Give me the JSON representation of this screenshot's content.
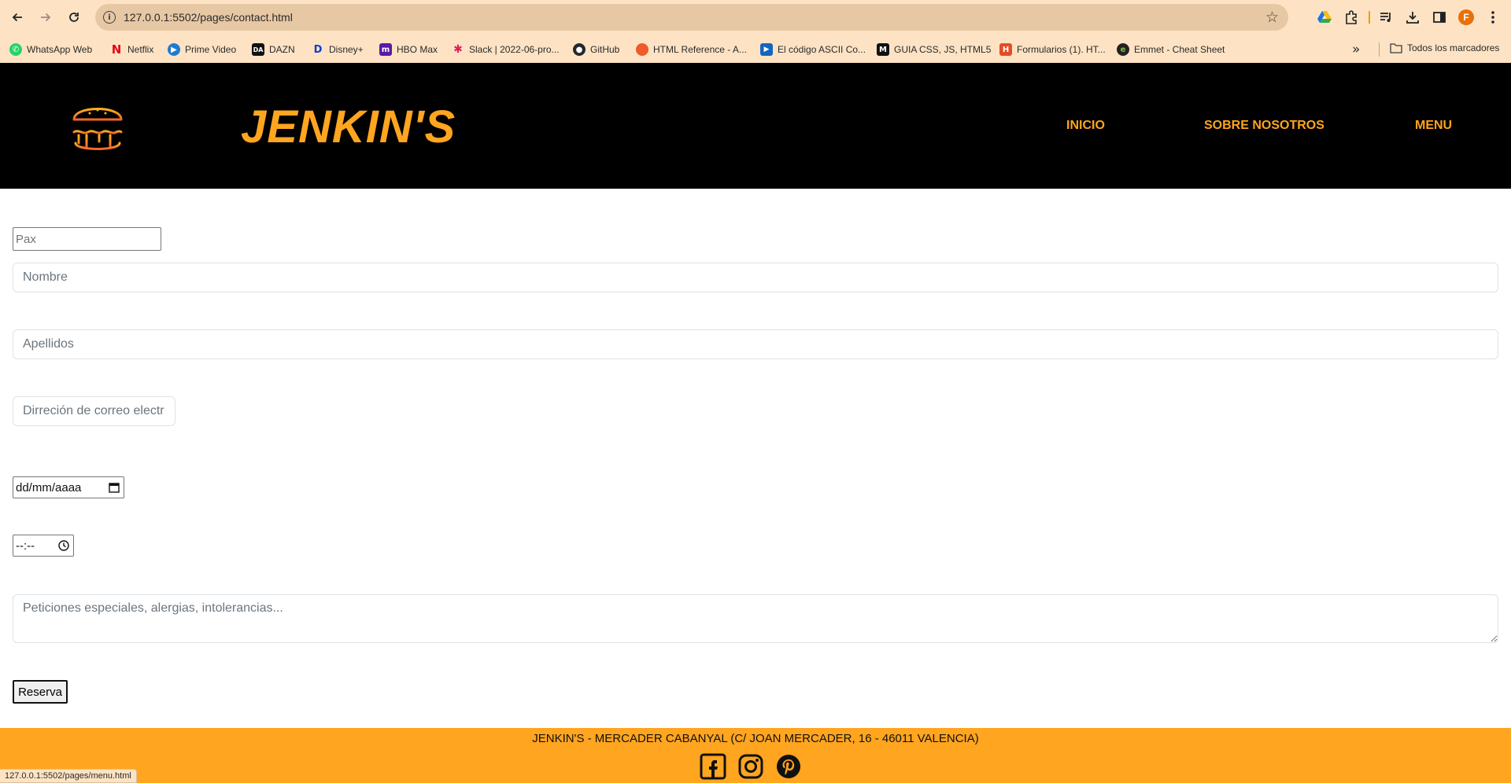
{
  "browser": {
    "url": "127.0.0.1:5502/pages/contact.html",
    "status_link": "127.0.0.1:5502/pages/menu.html",
    "profile_initial": "F",
    "bookmarks": [
      {
        "label": "WhatsApp Web",
        "icon": "whatsapp-icon"
      },
      {
        "label": "Netflix",
        "icon": "netflix-icon"
      },
      {
        "label": "Prime Video",
        "icon": "prime-video-icon"
      },
      {
        "label": "DAZN",
        "icon": "dazn-icon"
      },
      {
        "label": "Disney+",
        "icon": "disney-icon"
      },
      {
        "label": "HBO Max",
        "icon": "hbo-max-icon"
      },
      {
        "label": "Slack | 2022-06-pro...",
        "icon": "slack-icon"
      },
      {
        "label": "GitHub",
        "icon": "github-icon"
      },
      {
        "label": "HTML Reference - A...",
        "icon": "html-reference-icon"
      },
      {
        "label": "El código ASCII Co...",
        "icon": "ascii-icon"
      },
      {
        "label": "GUIA CSS, JS, HTML5",
        "icon": "guia-icon"
      },
      {
        "label": "Formularios (1). HT...",
        "icon": "html5-icon"
      },
      {
        "label": "Emmet - Cheat Sheet",
        "icon": "emmet-icon"
      }
    ],
    "all_bookmarks_label": "Todos los marcadores"
  },
  "header": {
    "brand": "JENKIN'S",
    "nav": [
      "INICIO",
      "SOBRE NOSOTROS",
      "MENU"
    ],
    "accent_color": "#ffa51f"
  },
  "form": {
    "pax_placeholder": "Pax",
    "nombre_placeholder": "Nombre",
    "apellidos_placeholder": "Apellidos",
    "email_placeholder": "Dirreción de correo electr",
    "date_value": "dd/mm/aaaa",
    "time_value": "--:--",
    "peticiones_placeholder": "Peticiones especiales, alergias, intolerancias...",
    "submit_label": "Reserva"
  },
  "footer": {
    "address": "JENKIN'S - MERCADER CABANYAL (C/ JOAN MERCADER, 16 - 46011 VALENCIA)",
    "social": [
      "facebook-icon",
      "instagram-icon",
      "pinterest-icon"
    ],
    "color": "#ffa51f"
  }
}
